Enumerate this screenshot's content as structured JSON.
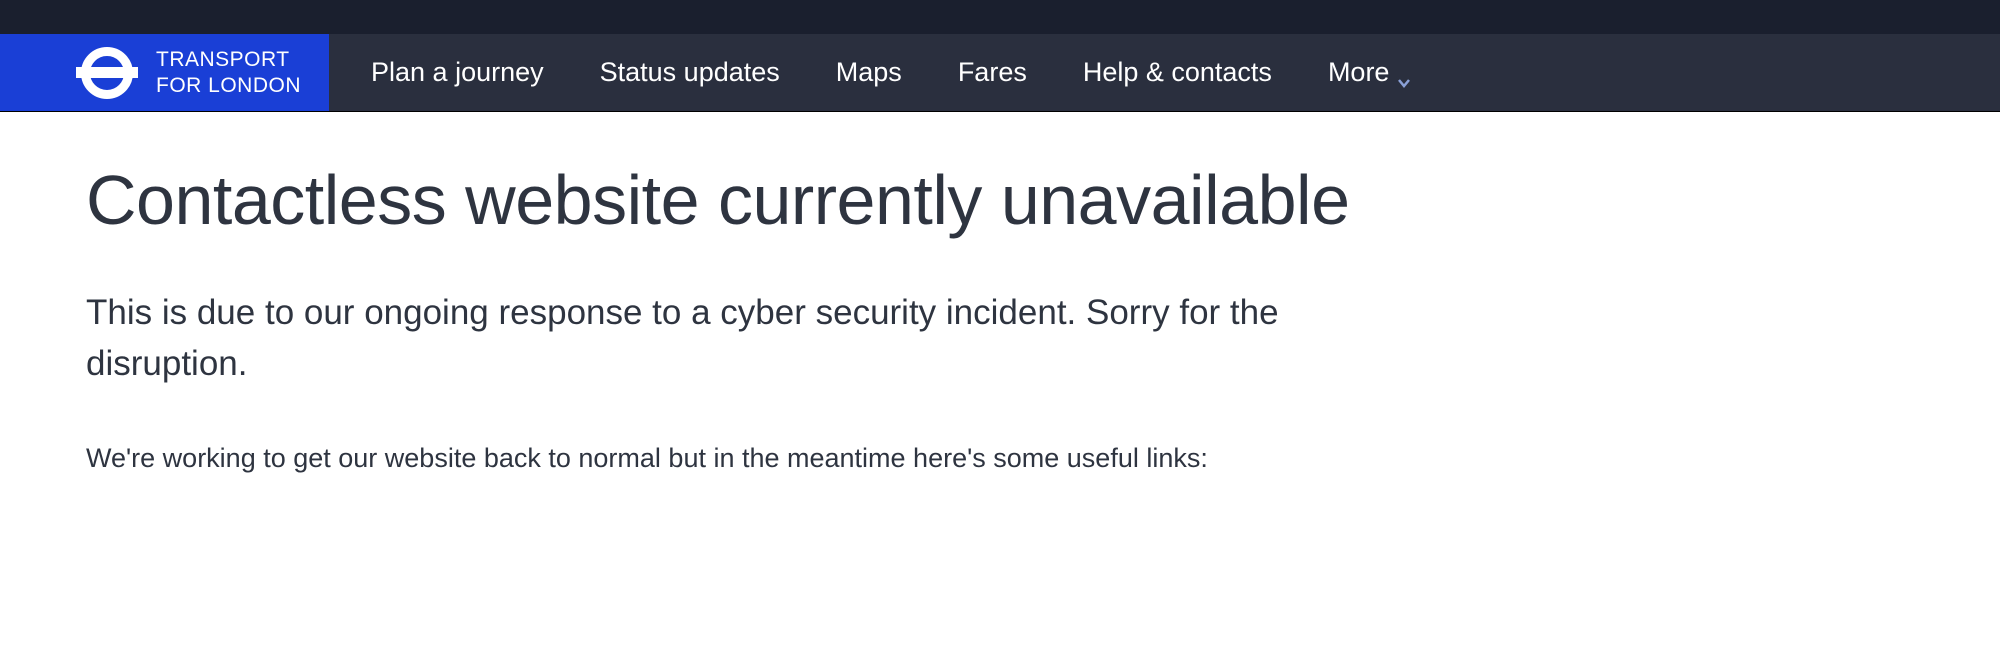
{
  "logo": {
    "line1": "TRANSPORT",
    "line2": "FOR LONDON"
  },
  "nav": {
    "items": [
      "Plan a journey",
      "Status updates",
      "Maps",
      "Fares",
      "Help & contacts"
    ],
    "more": "More"
  },
  "page": {
    "title": "Contactless website currently unavailable",
    "lead": "This is due to our ongoing response to a cyber security incident. Sorry for the disruption.",
    "body": "We're working to get our website back to normal but in the meantime here's some useful links:"
  }
}
